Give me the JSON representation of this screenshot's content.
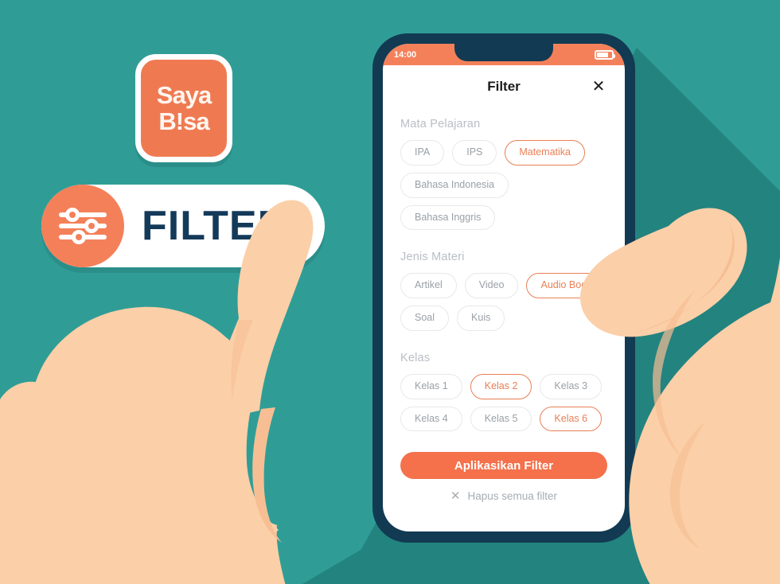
{
  "brand": {
    "logo_line1": "Saya",
    "logo_line2_a": "B",
    "logo_line2_bang": "!",
    "logo_line2_b": "sa",
    "badge_label": "FILTER"
  },
  "colors": {
    "teal_base": "#2F9D96",
    "teal_shadow": "#23837F",
    "orange": "#F4805A",
    "orange_button": "#F4714B",
    "navy": "#123A52",
    "skin": "#FBCFA8",
    "skin_shade": "#F7BE93",
    "chip_border": "#E6E8EA",
    "chip_text": "#9AA0A6",
    "accent_text": "#E87F55"
  },
  "phone": {
    "statusbar": {
      "time": "14:00",
      "battery_icon": "battery-icon"
    }
  },
  "sheet": {
    "title": "Filter",
    "close_icon": "close-icon",
    "sections": [
      {
        "heading": "Mata Pelajaran",
        "chips": [
          {
            "label": "IPA",
            "active": false
          },
          {
            "label": "IPS",
            "active": false
          },
          {
            "label": "Matematika",
            "active": true
          },
          {
            "label": "Bahasa Indonesia",
            "active": false
          },
          {
            "label": "Bahasa Inggris",
            "active": false
          }
        ]
      },
      {
        "heading": "Jenis Materi",
        "chips": [
          {
            "label": "Artikel",
            "active": false
          },
          {
            "label": "Video",
            "active": false
          },
          {
            "label": "Audio Book",
            "active": true
          },
          {
            "label": "Soal",
            "active": false
          },
          {
            "label": "Kuis",
            "active": false
          }
        ]
      },
      {
        "heading": "Kelas",
        "chips": [
          {
            "label": "Kelas 1",
            "active": false
          },
          {
            "label": "Kelas 2",
            "active": true
          },
          {
            "label": "Kelas 3",
            "active": false
          },
          {
            "label": "Kelas 4",
            "active": false
          },
          {
            "label": "Kelas 5",
            "active": false
          },
          {
            "label": "Kelas 6",
            "active": true
          }
        ]
      }
    ],
    "apply_label": "Aplikasikan Filter",
    "clear_label": "Hapus semua filter",
    "clear_icon": "close-icon"
  }
}
